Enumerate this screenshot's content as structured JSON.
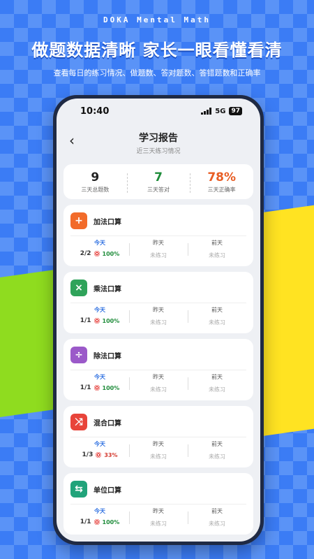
{
  "brand": "DOKA Mental Math",
  "headline": "做题数据清晰 家长一眼看懂看清",
  "subline": "查看每日的练习情况、做题数、答对题数、答错题数和正确率",
  "status": {
    "time": "10:40",
    "network": "5G",
    "battery": "97"
  },
  "nav": {
    "back_icon": "chevron-left-icon",
    "title": "学习报告",
    "subtitle": "近三天练习情况"
  },
  "summary": [
    {
      "value": "9",
      "label": "三天总题数",
      "color": "#222222"
    },
    {
      "value": "7",
      "label": "三天答对",
      "color": "#1e8c3a"
    },
    {
      "value": "78%",
      "label": "三天正确率",
      "color": "#e85d24"
    }
  ],
  "days": {
    "today": "今天",
    "yesterday": "昨天",
    "before": "前天",
    "not_practiced": "未练习"
  },
  "cards": [
    {
      "icon": "plus-icon",
      "glyph": "+",
      "color": "#f26b2a",
      "title": "加法口算",
      "score": "2/2",
      "rate": "100%",
      "rate_color": "#1e8c3a"
    },
    {
      "icon": "multiply-icon",
      "glyph": "×",
      "color": "#2fa35a",
      "title": "乘法口算",
      "score": "1/1",
      "rate": "100%",
      "rate_color": "#1e8c3a"
    },
    {
      "icon": "divide-icon",
      "glyph": "÷",
      "color": "#9b59c9",
      "title": "除法口算",
      "score": "1/1",
      "rate": "100%",
      "rate_color": "#1e8c3a"
    },
    {
      "icon": "shuffle-icon",
      "glyph": "⤨",
      "color": "#e8443a",
      "title": "混合口算",
      "score": "1/3",
      "rate": "33%",
      "rate_color": "#d43b30"
    },
    {
      "icon": "swap-icon",
      "glyph": "⇆",
      "color": "#21a37a",
      "title": "单位口算",
      "score": "1/1",
      "rate": "100%",
      "rate_color": "#1e8c3a"
    }
  ]
}
